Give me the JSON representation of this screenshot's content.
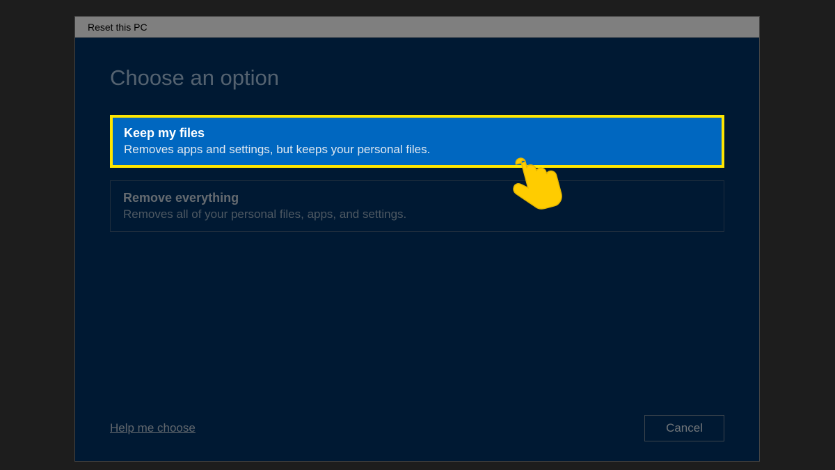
{
  "window": {
    "title": "Reset this PC"
  },
  "dialog": {
    "heading": "Choose an option",
    "options": [
      {
        "title": "Keep my files",
        "description": "Removes apps and settings, but keeps your personal files."
      },
      {
        "title": "Remove everything",
        "description": "Removes all of your personal files, apps, and settings."
      }
    ],
    "help_link": "Help me choose",
    "cancel_label": "Cancel"
  }
}
